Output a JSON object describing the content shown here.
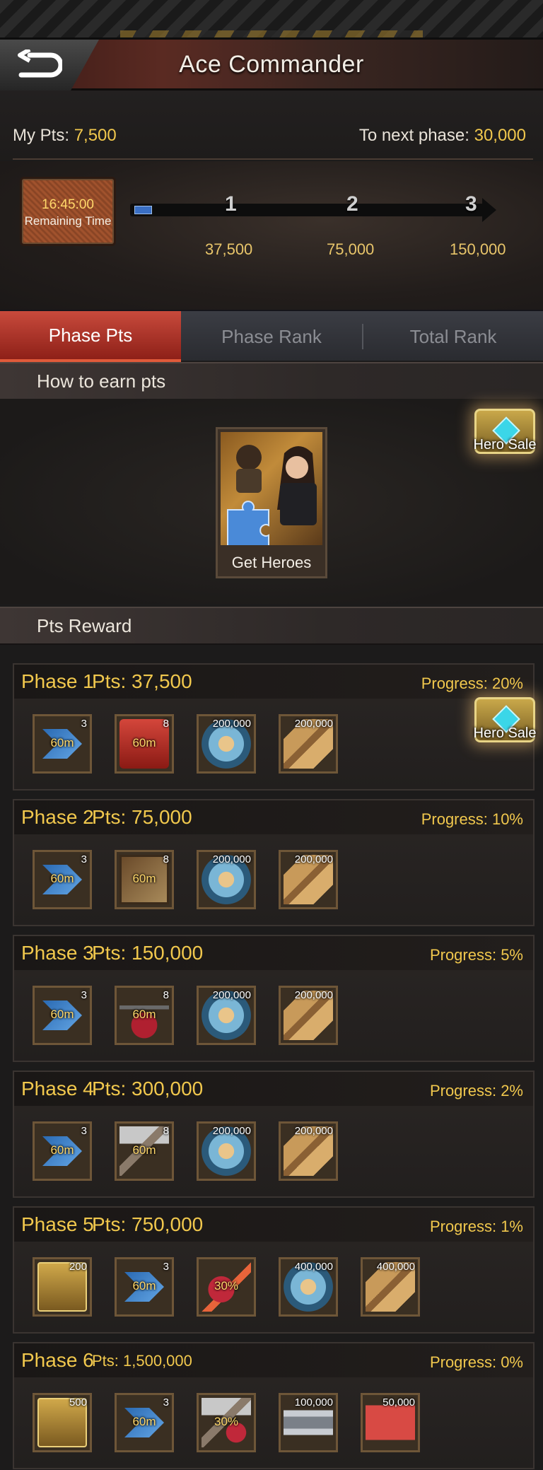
{
  "header": {
    "title": "Ace Commander",
    "back_icon": "back-arrow-icon"
  },
  "points": {
    "my_label": "My Pts:",
    "my_value": "7,500",
    "next_label": "To next phase:",
    "next_value": "30,000"
  },
  "timer": {
    "time": "16:45:00",
    "label": "Remaining Time"
  },
  "progress": {
    "fill_fraction": 0.05,
    "nodes": [
      {
        "num": "1",
        "value": "37,500"
      },
      {
        "num": "2",
        "value": "75,000"
      },
      {
        "num": "3",
        "value": "150,000"
      }
    ]
  },
  "tabs": [
    "Phase Pts",
    "Phase Rank",
    "Total Rank"
  ],
  "active_tab": 0,
  "earn": {
    "header": "How to earn pts",
    "card_label": "Get Heroes"
  },
  "hero_sale": {
    "label": "Hero Sale"
  },
  "rewards": {
    "header": "Pts Reward",
    "phases": [
      {
        "name": "Phase 1",
        "pts": "Pts: 37,500",
        "progress": "Progress: 20%",
        "items": [
          {
            "icon": "speedup-icon",
            "art": "speed",
            "qty": "3",
            "mid": "60m"
          },
          {
            "icon": "red-case-speedup-icon",
            "art": "redcase",
            "qty": "8",
            "mid": "60m"
          },
          {
            "icon": "food-can-icon",
            "art": "food",
            "qty": "200,000",
            "mid": ""
          },
          {
            "icon": "wood-planks-icon",
            "art": "wood",
            "qty": "200,000",
            "mid": ""
          }
        ]
      },
      {
        "name": "Phase 2",
        "pts": "Pts: 75,000",
        "progress": "Progress: 10%",
        "items": [
          {
            "icon": "speedup-icon",
            "art": "speed",
            "qty": "3",
            "mid": "60m"
          },
          {
            "icon": "book-speedup-icon",
            "art": "book",
            "qty": "8",
            "mid": "60m"
          },
          {
            "icon": "food-can-icon",
            "art": "food",
            "qty": "200,000",
            "mid": ""
          },
          {
            "icon": "wood-planks-icon",
            "art": "wood",
            "qty": "200,000",
            "mid": ""
          }
        ]
      },
      {
        "name": "Phase 3",
        "pts": "Pts: 150,000",
        "progress": "Progress: 5%",
        "items": [
          {
            "icon": "speedup-icon",
            "art": "speed",
            "qty": "3",
            "mid": "60m"
          },
          {
            "icon": "flask-speedup-icon",
            "art": "flask",
            "qty": "8",
            "mid": "60m"
          },
          {
            "icon": "food-can-icon",
            "art": "food",
            "qty": "200,000",
            "mid": ""
          },
          {
            "icon": "wood-planks-icon",
            "art": "wood",
            "qty": "200,000",
            "mid": ""
          }
        ]
      },
      {
        "name": "Phase 4",
        "pts": "Pts: 300,000",
        "progress": "Progress: 2%",
        "items": [
          {
            "icon": "speedup-icon",
            "art": "speed",
            "qty": "3",
            "mid": "60m"
          },
          {
            "icon": "hammer-speedup-icon",
            "art": "hammer",
            "qty": "8",
            "mid": "60m"
          },
          {
            "icon": "food-can-icon",
            "art": "food",
            "qty": "200,000",
            "mid": ""
          },
          {
            "icon": "wood-planks-icon",
            "art": "wood",
            "qty": "200,000",
            "mid": ""
          }
        ]
      },
      {
        "name": "Phase 5",
        "pts": "Pts: 750,000",
        "progress": "Progress: 1%",
        "items": [
          {
            "icon": "gem-chest-icon",
            "art": "chest",
            "qty": "200",
            "mid": ""
          },
          {
            "icon": "speedup-icon",
            "art": "speed",
            "qty": "3",
            "mid": "60m"
          },
          {
            "icon": "research-boost-icon",
            "art": "boost",
            "qty": "",
            "mid": "30%"
          },
          {
            "icon": "food-can-icon",
            "art": "food",
            "qty": "400,000",
            "mid": ""
          },
          {
            "icon": "wood-planks-icon",
            "art": "wood",
            "qty": "400,000",
            "mid": ""
          }
        ]
      },
      {
        "name": "Phase 6",
        "pts": "Pts: 1,500,000",
        "progress": "Progress: 0%",
        "items": [
          {
            "icon": "gem-chest-icon",
            "art": "chest",
            "qty": "500",
            "mid": ""
          },
          {
            "icon": "speedup-icon",
            "art": "speed",
            "qty": "3",
            "mid": "60m"
          },
          {
            "icon": "build-boost-icon",
            "art": "hammerboost",
            "qty": "",
            "mid": "30%"
          },
          {
            "icon": "steel-ingot-icon",
            "art": "steel",
            "qty": "100,000",
            "mid": ""
          },
          {
            "icon": "oil-can-icon",
            "art": "oil",
            "qty": "50,000",
            "mid": ""
          }
        ]
      }
    ]
  }
}
